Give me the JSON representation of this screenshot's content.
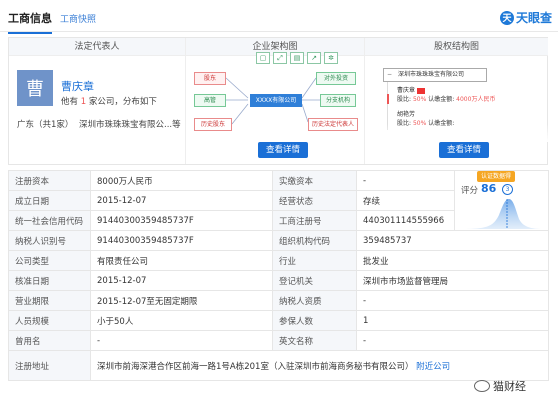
{
  "tabs": {
    "active": "工商信息",
    "other": "工商快照"
  },
  "logo": {
    "mark": "天",
    "text": "天眼查"
  },
  "legal_rep": {
    "header": "法定代表人",
    "avatar_char": "曹",
    "name": "曹庆章",
    "desc_prefix": "他有",
    "desc_count": "1",
    "desc_suffix": "家公司，分布如下",
    "location": "广东（共1家）",
    "company": "深圳市珠珠珠宝有限公...等"
  },
  "enterprise_diagram": {
    "header": "企业架构图",
    "nodes": {
      "shareholder": "股东",
      "executive": "高管",
      "history_shareholder": "历史股东",
      "center": "XXXX有限公司",
      "outbound_investment": "对外投资",
      "branch": "分支机构",
      "history_legal_rep": "历史法定代表人"
    },
    "button": "查看详情"
  },
  "equity_structure": {
    "header": "股权结构图",
    "company": "深圳市珠珠珠宝有限公司",
    "holder1_name": "曹庆章",
    "holder1_ratio_label": "股比:",
    "holder1_ratio": "50%",
    "holder1_amount_label": "认缴金额:",
    "holder1_amount": "4000万人民币",
    "holder2_name": "胡艳芳",
    "holder2_ratio_label": "股比:",
    "holder2_ratio": "50%",
    "holder2_amount_label": "认缴金额:",
    "button": "查看详情"
  },
  "score": {
    "badge": "认证数据得",
    "label": "评分",
    "value": "86",
    "icon": "3"
  },
  "info_rows": [
    {
      "l1": "注册资本",
      "v1": "8000万人民币",
      "l2": "实缴资本",
      "v2": "-"
    },
    {
      "l1": "成立日期",
      "v1": "2015-12-07",
      "l2": "经营状态",
      "v2": "存续"
    },
    {
      "l1": "统一社会信用代码",
      "v1": "91440300359485737F",
      "l2": "工商注册号",
      "v2": "440301114555966"
    },
    {
      "l1": "纳税人识别号",
      "v1": "91440300359485737F",
      "l2": "组织机构代码",
      "v2": "359485737"
    },
    {
      "l1": "公司类型",
      "v1": "有限责任公司",
      "l2": "行业",
      "v2": "批发业"
    },
    {
      "l1": "核准日期",
      "v1": "2015-12-07",
      "l2": "登记机关",
      "v2": "深圳市市场监督管理局"
    },
    {
      "l1": "营业期限",
      "v1": "2015-12-07至无固定期限",
      "l2": "纳税人资质",
      "v2": "-"
    },
    {
      "l1": "人员规模",
      "v1": "小于50人",
      "l2": "参保人数",
      "v2": "1"
    },
    {
      "l1": "曾用名",
      "v1": "-",
      "l2": "英文名称",
      "v2": "-"
    }
  ],
  "address": {
    "label": "注册地址",
    "value": "深圳市前海深港合作区前海一路1号A栋201室（入驻深圳市前海商务秘书有限公司）",
    "link": "附近公司"
  },
  "watermark": "猫财经"
}
